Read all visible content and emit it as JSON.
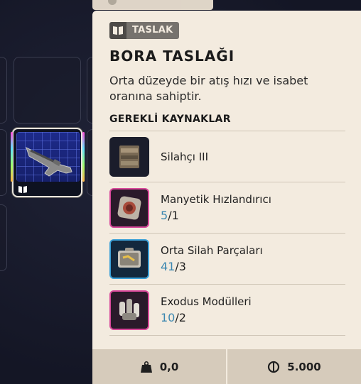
{
  "tooltip": {
    "type_label": "TASLAK",
    "type_icon": "book-icon",
    "title": "BORA TASLAĞI",
    "description": "Orta düzeyde bir atış hızı ve isabet oranına sahiptir.",
    "requirements_heading": "GEREKLİ KAYNAKLAR",
    "resources": [
      {
        "name": "Silahçı III",
        "have": "",
        "need": "",
        "icon": "workbench-icon"
      },
      {
        "name": "Manyetik Hızlandırıcı",
        "have": "5",
        "need": "1",
        "icon": "accelerator-icon"
      },
      {
        "name": "Orta Silah Parçaları",
        "have": "41",
        "need": "3",
        "icon": "weapon-parts-icon"
      },
      {
        "name": "Exodus Modülleri",
        "have": "10",
        "need": "2",
        "icon": "modules-icon"
      }
    ],
    "weight": "0,0",
    "price": "5.000"
  },
  "colors": {
    "panel_bg": "#f3ebdf",
    "footer_bg": "#d6cbbb",
    "have_count": "#3b87b0",
    "background": "#151726",
    "pink_rarity": "#d8489a",
    "blue_rarity": "#3aa0d8"
  },
  "slot_icons": {
    "selected_item": "blueprint-weapon-icon",
    "badge": "book-icon"
  }
}
